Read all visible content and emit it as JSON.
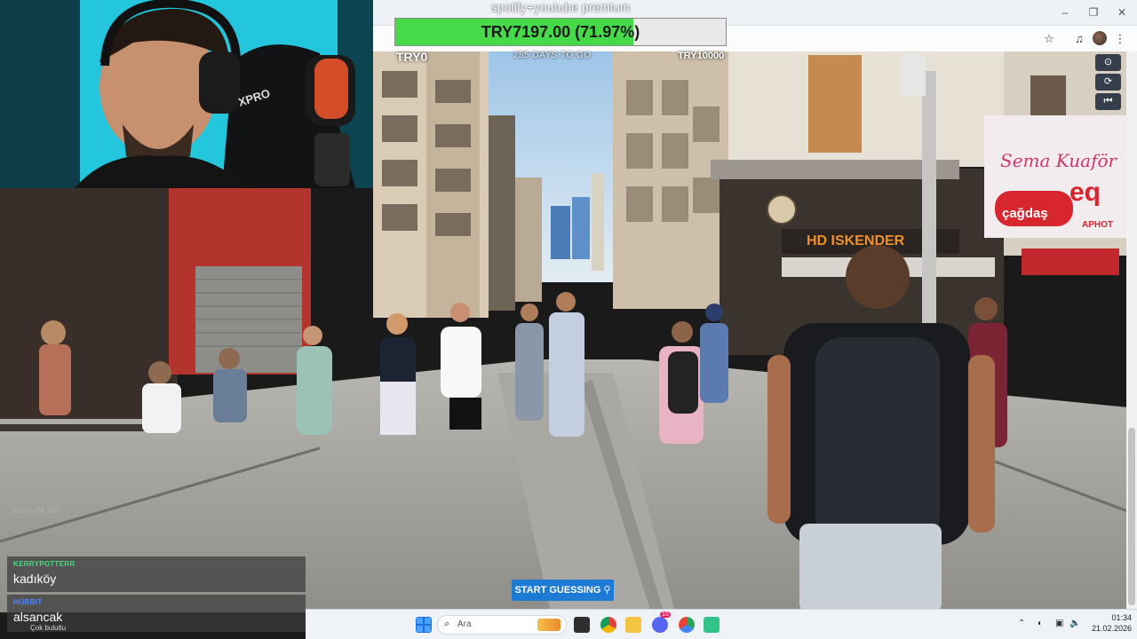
{
  "goal": {
    "title": "spotify+youtube premium",
    "amount_text": "TRY7197.00 (71.97%)",
    "progress_fraction": 0.7197,
    "min_label": "TRY0",
    "days_left": "285 DAYS TO GO",
    "max_label": "TRY10000",
    "colors": {
      "fill": "#46d94a",
      "track": "#e9e9e9"
    }
  },
  "browser": {
    "minimize_icon": "minimize-icon",
    "restore_icon": "restore-icon",
    "close_icon": "close-icon",
    "bookmark_icon": "star-icon",
    "media_icon": "media-playlist-icon",
    "menu_icon": "kebab-menu-icon",
    "glyphs": {
      "minimize": "–",
      "restore": "❐",
      "close": "✕",
      "star": "☆",
      "media": "♫",
      "menu": "⋮"
    }
  },
  "geo_controls": [
    {
      "name": "compass-icon",
      "glyph": "⊙"
    },
    {
      "name": "rotate-icon",
      "glyph": "⟳"
    },
    {
      "name": "return-to-start-icon",
      "glyph": "⏮"
    }
  ],
  "scene": {
    "signs": {
      "restaurant": "HD ISKENDER",
      "store_red": "çağdaş",
      "store_handwritten": "Sema Kuaför",
      "store_partial": "eq",
      "store_partial_sub": "APHOT"
    }
  },
  "webcam": {
    "mic_brand": "XPRO"
  },
  "chat": [
    {
      "user": "KERRYPOTTERR",
      "text": "kadıköy",
      "user_color": "#3edc7f"
    },
    {
      "user": "HOBBIT",
      "text": "alsancak",
      "user_color": "#4f86ff"
    }
  ],
  "chat_ghost": "bunu da bul",
  "chat_sub": "Çok bulutlu",
  "start_button": {
    "label": "START GUESSING",
    "icon": "map-pin-icon",
    "glyph": "⚲",
    "color": "#1e7bd4"
  },
  "taskbar": {
    "search_placeholder": "Ara",
    "search_icon_glyph": "⌕",
    "time": "01:34",
    "date": "21.02.2026",
    "apps": [
      {
        "name": "windows-start-icon",
        "color": "#1f6fe0"
      },
      {
        "name": "task-view-icon",
        "color": "#333333"
      },
      {
        "name": "chrome-icon",
        "color": "#db4437"
      },
      {
        "name": "file-explorer-icon",
        "color": "#f4c542"
      },
      {
        "name": "discord-icon",
        "color": "#5865f2"
      },
      {
        "name": "chrome-beta-icon",
        "color": "#2aa65a"
      },
      {
        "name": "streamlabs-icon",
        "color": "#31c38a"
      }
    ],
    "discord_badge": "10",
    "tray_glyphs": {
      "chevron": "⌃",
      "network": "◐",
      "display": "▣",
      "volume": "🔈"
    }
  }
}
